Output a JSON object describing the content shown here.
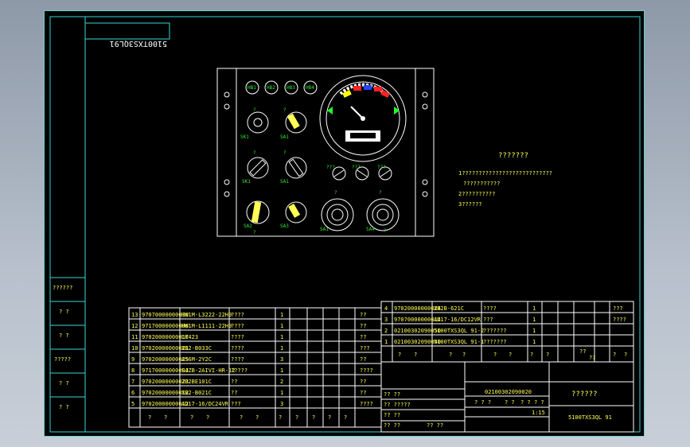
{
  "titles": {
    "mirrored_code": "5100TXS3QL91",
    "drawing_number": "02100302090020",
    "drawing_name": "??????",
    "product_code": "5100TXS3QL 91",
    "scale": "1:15"
  },
  "notes": {
    "heading": "???????",
    "line1": "1???????????????????????????",
    "line2": "???????????",
    "line3": "2??????????",
    "line4": "3??????"
  },
  "left_column": [
    "??????",
    "? ?",
    "? ?",
    "?????",
    "? ?",
    "? ?"
  ],
  "panel": {
    "indicators": [
      "HB1",
      "HB2",
      "HB3",
      "HB4"
    ],
    "switches": [
      "SK1",
      "SA1",
      "SK1",
      "SA1",
      "SA2",
      "SA3",
      "SA1",
      "SA4"
    ],
    "labels": [
      "?",
      "?",
      "?",
      "?",
      "?",
      "?",
      "?",
      "?"
    ]
  },
  "bom_left": [
    {
      "no": "13",
      "code": "97070000000010",
      "spec": "HW1M-L3222-22H9",
      "name": "????",
      "qty": "1",
      "note": "??"
    },
    {
      "no": "12",
      "code": "97170000000006",
      "spec": "HW1M-L1111-22H9",
      "name": "????",
      "qty": "1",
      "note": "??"
    },
    {
      "no": "11",
      "code": "97020000000017",
      "spec": "LK423",
      "name": "????",
      "qty": "1",
      "note": "??"
    },
    {
      "no": "10",
      "code": "97020000000021",
      "spec": "XB2-B033C",
      "name": "????",
      "qty": "1",
      "note": "???"
    },
    {
      "no": "9",
      "code": "97020000000025",
      "spec": "AS6M-2Y2C",
      "name": "????",
      "qty": "3",
      "note": "??"
    },
    {
      "no": "8",
      "code": "97170000000004",
      "spec": "SJZB-2AIVI-HR-12",
      "name": "?????",
      "qty": "1",
      "note": "????"
    },
    {
      "no": "7",
      "code": "97020000000023",
      "spec": "ZB2BE101C",
      "name": "??",
      "qty": "2",
      "note": "??"
    },
    {
      "no": "6",
      "code": "97020000000012",
      "spec": "XB2-B021C",
      "name": "??",
      "qty": "1",
      "note": "??"
    },
    {
      "no": "5",
      "code": "97020000000012",
      "spec": "AD17-16/DC24VR",
      "name": "???",
      "qty": "3",
      "note": "????"
    }
  ],
  "bom_left_header": [
    "?",
    "?",
    "?",
    "?",
    "?",
    "?",
    "?",
    "?",
    "?",
    "?",
    "?"
  ],
  "bom_right": [
    {
      "no": "4",
      "code": "97020000000024",
      "spec": "XB2B-621C",
      "name": "????",
      "qty": "1",
      "note": "???"
    },
    {
      "no": "3",
      "code": "97070000000014",
      "spec": "AD17-16/DC12VR",
      "name": "???",
      "qty": "1",
      "note": "????"
    },
    {
      "no": "2",
      "code": "02100302090050",
      "spec": "5100TXS3QL 91-2",
      "name": "???????",
      "qty": "1",
      "note": ""
    },
    {
      "no": "1",
      "code": "02100302090040",
      "spec": "5100TXS3QL 91-1",
      "name": "???????",
      "qty": "1",
      "note": ""
    }
  ],
  "bom_right_header": [
    "?",
    "?",
    "?",
    "?",
    "?",
    "?",
    "?",
    "?",
    "??",
    "??",
    "?",
    "?"
  ],
  "title_block": {
    "rows": [
      "?? ??",
      "?? ?????",
      "?? ??",
      "?? ??",
      "?? ??"
    ],
    "labels": [
      "? ? ?",
      "? ?",
      "? ?",
      "? ?"
    ]
  },
  "colors": {
    "frame": "#39d6d6",
    "lines": "#ffffff",
    "text": "#ffff55",
    "panel_labels": "#2ee82e"
  }
}
